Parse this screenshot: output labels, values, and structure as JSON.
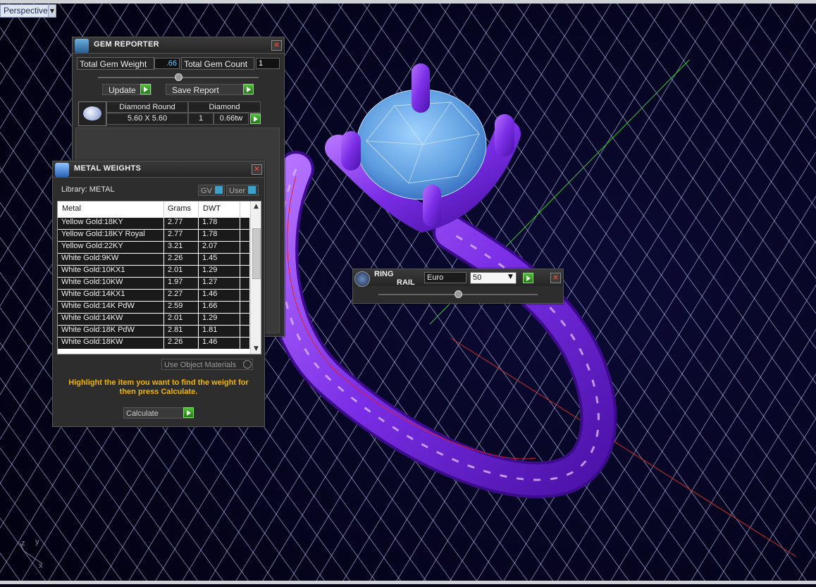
{
  "viewport": {
    "label": "Perspective",
    "axes": {
      "z": "z",
      "y": "y",
      "x": "x"
    }
  },
  "gem_reporter": {
    "title": "GEM REPORTER",
    "total_gem_weight_label": "Total Gem Weight",
    "total_gem_weight_value": ".66",
    "total_gem_count_label": "Total Gem Count",
    "total_gem_count_value": "1",
    "update_label": "Update",
    "save_report_label": "Save Report",
    "gem": {
      "shape": "Diamond Round",
      "type": "Diamond",
      "size": "5.60 X 5.60",
      "count": "1",
      "weight": "0.66tw"
    }
  },
  "metal_weights": {
    "title": "METAL WEIGHTS",
    "library": "Library: METAL",
    "gv_label": "GV",
    "user_label": "User",
    "columns": [
      "Metal",
      "Grams",
      "DWT"
    ],
    "rows": [
      [
        "Yellow Gold:18KY",
        "2.77",
        "1.78"
      ],
      [
        "Yellow Gold:18KY Royal",
        "2.77",
        "1.78"
      ],
      [
        "Yellow Gold:22KY",
        "3.21",
        "2.07"
      ],
      [
        "White Gold:9KW",
        "2.26",
        "1.45"
      ],
      [
        "White Gold:10KX1",
        "2.01",
        "1.29"
      ],
      [
        "White Gold:10KW",
        "1.97",
        "1.27"
      ],
      [
        "White Gold:14KX1",
        "2.27",
        "1.46"
      ],
      [
        "White Gold:14K PdW",
        "2.59",
        "1.66"
      ],
      [
        "White Gold:14KW",
        "2.01",
        "1.29"
      ],
      [
        "White Gold:18K PdW",
        "2.81",
        "1.81"
      ],
      [
        "White Gold:18KW",
        "2.26",
        "1.46"
      ]
    ],
    "use_object_materials_label": "Use Object Materials",
    "message": "Highlight the item you want to find the weight for then press Calculate.",
    "calculate_label": "Calculate"
  },
  "ring_rail": {
    "title_line1": "RING",
    "title_line2": "RAIL",
    "size_system": "Euro",
    "size_value": "50"
  },
  "colors": {
    "background": "#05031a",
    "grid": "#cfd8ff",
    "ring": "#8a3cf0",
    "gem": "#6fb4f0",
    "accent_value": "#5cc8ff",
    "message": "#f0b400"
  }
}
